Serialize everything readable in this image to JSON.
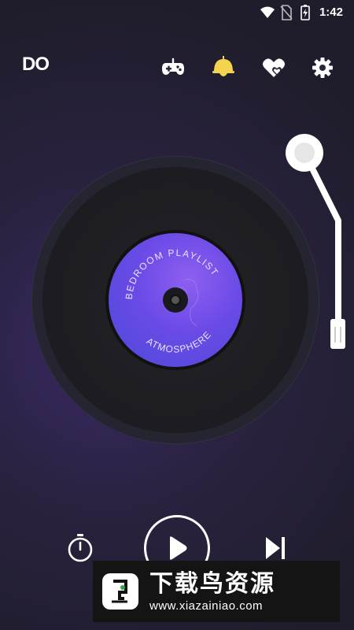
{
  "status_bar": {
    "time": "1:42",
    "icons": [
      "wifi-icon",
      "no-sim-icon",
      "battery-charging-icon"
    ]
  },
  "top_bar": {
    "logo": "DO",
    "actions": [
      {
        "name": "gamepad-icon",
        "color": "#ffffff"
      },
      {
        "name": "night-lamp-icon",
        "color": "#f4d34f"
      },
      {
        "name": "favorites-icon",
        "color": "#ffffff"
      },
      {
        "name": "settings-icon",
        "color": "#ffffff"
      }
    ]
  },
  "record": {
    "label_top": "BEDROOM PLAYLIST",
    "label_bottom": "ATMOSPHERE",
    "label_color": "#6a4ae6"
  },
  "controls": {
    "left": "timer-icon",
    "center": "play-icon",
    "right": "skip-next-icon"
  },
  "watermark": {
    "title": "下载鸟资源",
    "url": "www.xiazainiao.com"
  }
}
